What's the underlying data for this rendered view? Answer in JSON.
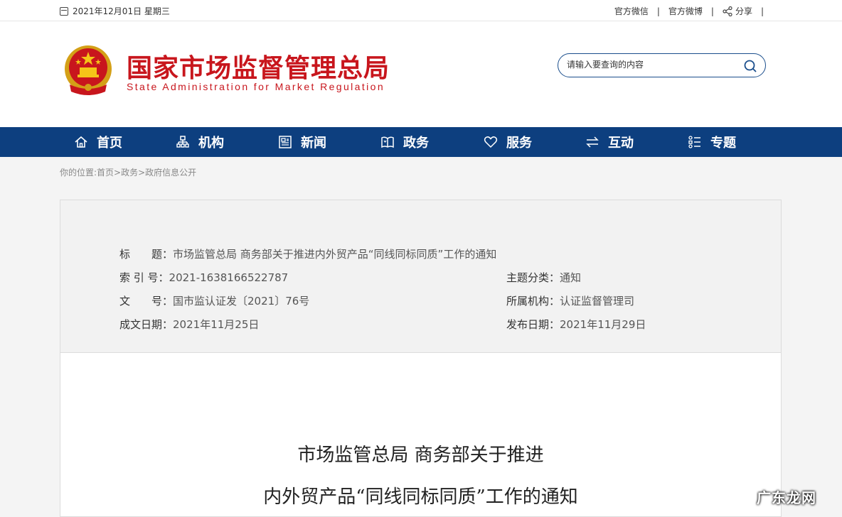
{
  "topbar": {
    "date": "2021年12月01日 星期三",
    "links": [
      "官方微信",
      "官方微博"
    ],
    "share": "分享",
    "separator": "|"
  },
  "header": {
    "title_cn": "国家市场监督管理总局",
    "title_en": "State Administration for Market Regulation"
  },
  "search": {
    "placeholder": "请输入要查询的内容"
  },
  "nav": {
    "items": [
      {
        "label": "首页",
        "icon": "home-icon"
      },
      {
        "label": "机构",
        "icon": "org-chart-icon"
      },
      {
        "label": "新闻",
        "icon": "newspaper-icon"
      },
      {
        "label": "政务",
        "icon": "book-icon"
      },
      {
        "label": "服务",
        "icon": "heart-icon"
      },
      {
        "label": "互动",
        "icon": "exchange-icon"
      },
      {
        "label": "专题",
        "icon": "topic-list-icon"
      }
    ]
  },
  "breadcrumb": "你的位置:首页>政务>政府信息公开",
  "meta": {
    "title_label": "标　　题：",
    "title_value": "市场监管总局 商务部关于推进内外贸产品“同线同标同质”工作的通知",
    "index_label": "索 引 号：",
    "index_value": "2021-1638166522787",
    "topic_label": "主题分类：",
    "topic_value": "通知",
    "docno_label": "文　　号：",
    "docno_value": "国市监认证发〔2021〕76号",
    "org_label": "所属机构：",
    "org_value": "认证监督管理司",
    "created_label": "成文日期：",
    "created_value": "2021年11月25日",
    "published_label": "发布日期：",
    "published_value": "2021年11月29日"
  },
  "document": {
    "title_line1": "市场监管总局 商务部关于推进",
    "title_line2": "内外贸产品“同线同标同质”工作的通知"
  },
  "watermark": "广东龙网",
  "colors": {
    "nav_bg": "#0d3f7f",
    "brand_red": "#c8161d",
    "search_border": "#1a4e8c"
  }
}
